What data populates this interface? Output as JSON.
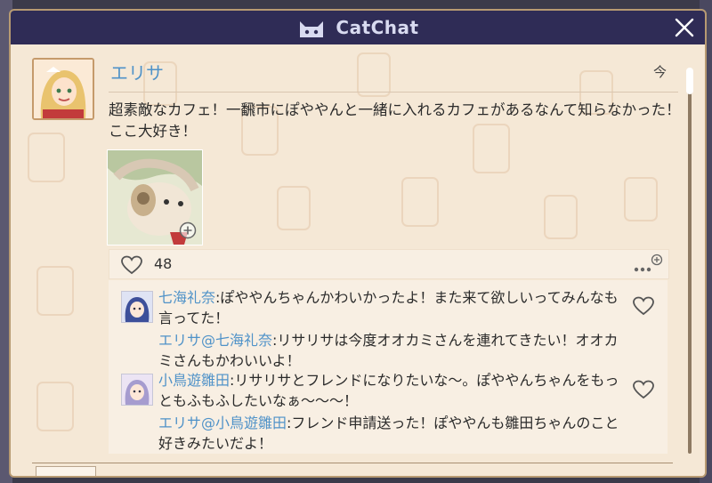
{
  "window": {
    "title": "CatChat"
  },
  "post": {
    "username": "エリサ",
    "timestamp": "今",
    "text": "超素敵なカフェ！一飜市にぽややんと一緒に入れるカフェがあるなんて知らなかった！ここ大好き！",
    "likes": "48"
  },
  "comments": [
    {
      "author": "七海礼奈",
      "text": ":ぽややんちゃんかわいかったよ！また来て欲しいってみんなも言ってた！",
      "reply_author": "エリサ@七海礼奈",
      "reply_text": ":リサリサは今度オオカミさんを連れてきたい！オオカミさんもかわいいよ！"
    },
    {
      "author": "小鳥遊雛田",
      "text": ":リサリサとフレンドになりたいな〜。ぽややんちゃんをもっともふもふしたいなぁ〜〜〜！",
      "reply_author": "エリサ@小鳥遊雛田",
      "reply_text": ":フレンド申請送った！ぽややんも雛田ちゃんのこと好きみたいだよ！"
    }
  ],
  "icons": {
    "logo": "cat-face-icon",
    "close": "close-icon",
    "like": "heart-icon",
    "more": "more-options-icon",
    "zoom": "zoom-in-icon"
  },
  "colors": {
    "title_bar": "#2f2c56",
    "panel": "#f5e8d6",
    "name": "#4f92c8",
    "border": "#b79a72"
  }
}
